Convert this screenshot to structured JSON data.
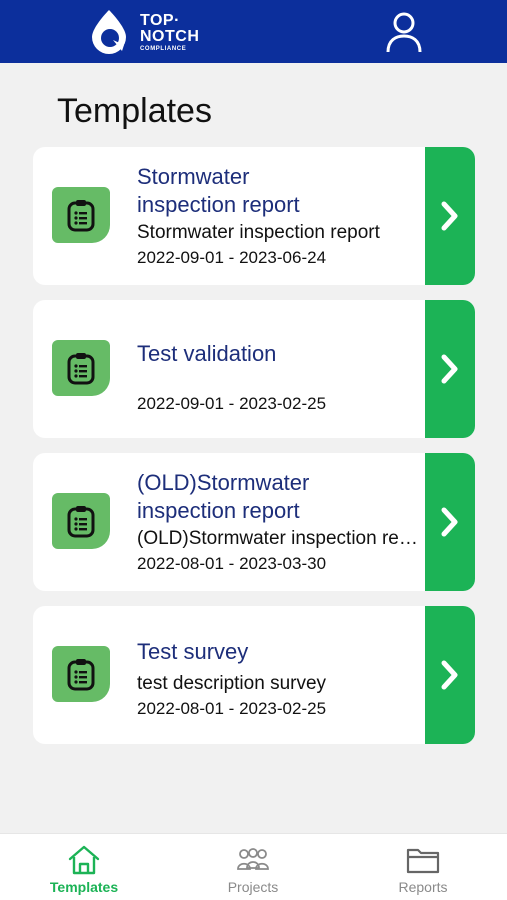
{
  "header": {
    "brand_line1": "TOP·",
    "brand_line2": "NOTCH",
    "brand_line3": "COMPLIANCE",
    "profile_icon": "user-icon"
  },
  "page": {
    "title": "Templates"
  },
  "templates": [
    {
      "title_line1": "Stormwater",
      "title_line2": "inspection report",
      "description": "Stormwater inspection report",
      "dates": "2022-09-01 - 2023-06-24"
    },
    {
      "title_line1": "Test validation",
      "title_line2": "",
      "description": "",
      "dates": "2022-09-01 - 2023-02-25"
    },
    {
      "title_line1": "(OLD)Stormwater",
      "title_line2": "inspection report",
      "description": "(OLD)Stormwater inspection report",
      "dates": "2022-08-01 - 2023-03-30"
    },
    {
      "title_line1": "Test survey",
      "title_line2": "",
      "description": "test description survey",
      "dates": "2022-08-01 - 2023-02-25"
    }
  ],
  "nav": {
    "items": [
      {
        "label": "Templates",
        "icon": "home-icon",
        "active": true
      },
      {
        "label": "Projects",
        "icon": "group-icon",
        "active": false
      },
      {
        "label": "Reports",
        "icon": "folder-icon",
        "active": false
      }
    ]
  },
  "colors": {
    "header_bg": "#0c2f9c",
    "accent_green": "#1cb356",
    "icon_green": "#66bb66",
    "title_blue": "#1d2e7a"
  }
}
